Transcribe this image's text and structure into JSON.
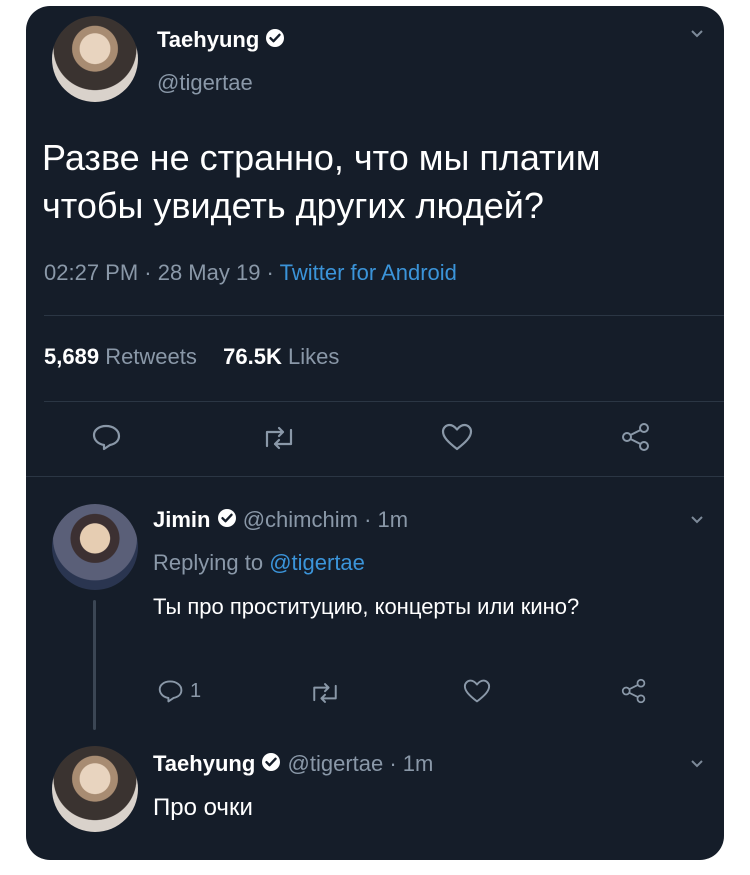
{
  "tweet": {
    "author_name": "Taehyung",
    "author_handle": "@tigertae",
    "text_line1": "Разве не странно, что мы платим",
    "text_line2": "чтобы увидеть других людей?",
    "time": "02:27 PM · 28 May 19 · ",
    "source": "Twitter for Android",
    "retweets_count": "5,689",
    "retweets_label": "Retweets",
    "likes_count": "76.5K",
    "likes_label": "Likes"
  },
  "reply1": {
    "author_name": "Jimin",
    "author_handle": "@chimchim · 1m",
    "replying_to_prefix": "Replying to ",
    "replying_to_handle": "@tigertae",
    "text": "Ты про проституцию, концерты или кино?",
    "reply_count": "1"
  },
  "reply2": {
    "author_name": "Taehyung",
    "author_handle": "@tigertae · 1m",
    "text": "Про очки"
  },
  "icons": {
    "reply": "reply-icon",
    "retweet": "retweet-icon",
    "like": "heart-icon",
    "share": "share-icon",
    "verified": "verified-badge-icon",
    "chevron": "chevron-down-icon"
  },
  "colors": {
    "background": "#151d29",
    "link": "#3b94d9",
    "muted": "#8a98a8"
  }
}
